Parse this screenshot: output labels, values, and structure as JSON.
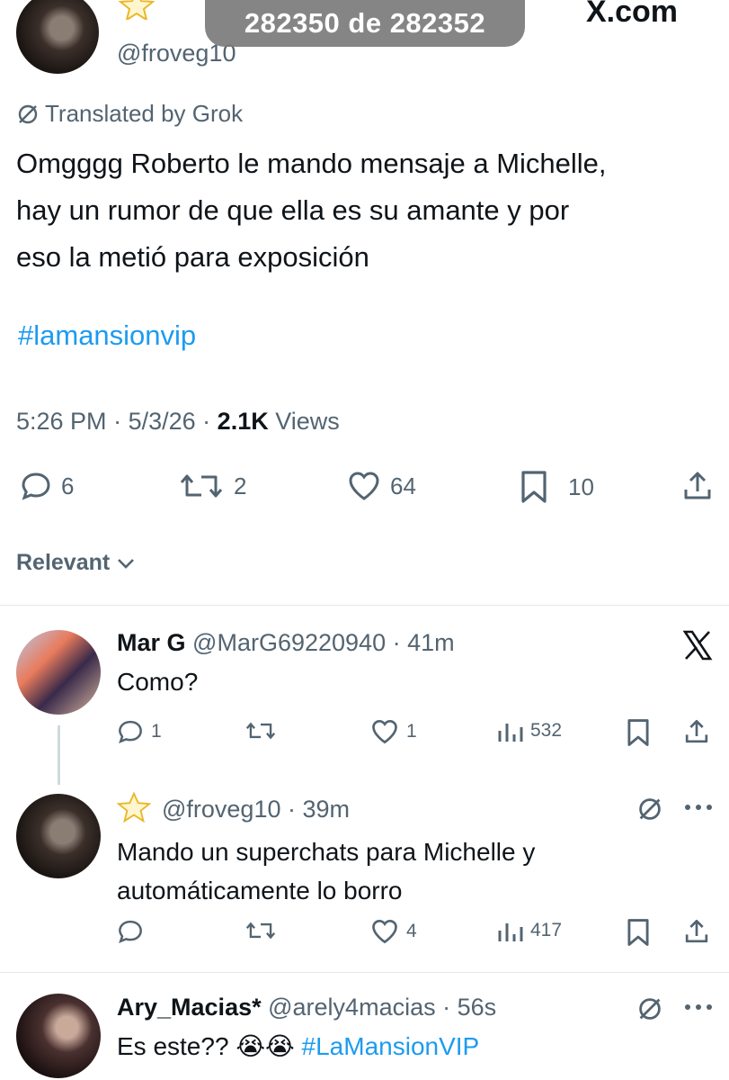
{
  "overlay": {
    "counter": "282350 de 282352",
    "watermark": "X.com"
  },
  "tweet": {
    "handle": "@froveg10",
    "translated_by": "Translated by Grok",
    "body_lines": [
      "Omgggg Roberto le mando mensaje a Michelle,",
      "hay un rumor de que ella es su amante y por",
      "eso la metió para exposición"
    ],
    "hashtag": "#lamansionvip",
    "time": "5:26 PM",
    "date": "5/3/26",
    "views_count": "2.1K",
    "views_label": "Views",
    "replies": "6",
    "reposts": "2",
    "likes": "64",
    "bookmarks": "10"
  },
  "sort": {
    "label": "Relevant"
  },
  "replies": [
    {
      "name": "Mar G",
      "handle": "@MarG69220940",
      "time": "41m",
      "text": "Como?",
      "replies": "1",
      "reposts": "",
      "likes": "1",
      "views": "532"
    },
    {
      "handle": "@froveg10",
      "time": "39m",
      "text_lines": [
        "Mando un superchats para Michelle y",
        "automáticamente lo borro"
      ],
      "replies": "",
      "reposts": "",
      "likes": "4",
      "views": "417"
    },
    {
      "name": "Ary_Macias*",
      "handle": "@arely4macias",
      "time": "56s",
      "text": "Es este??",
      "emojis": "😭😭",
      "hashtag": "#LaMansionVIP"
    }
  ],
  "colors": {
    "accent": "#1d9bf0",
    "muted": "#536471",
    "star": "#f5c518"
  }
}
